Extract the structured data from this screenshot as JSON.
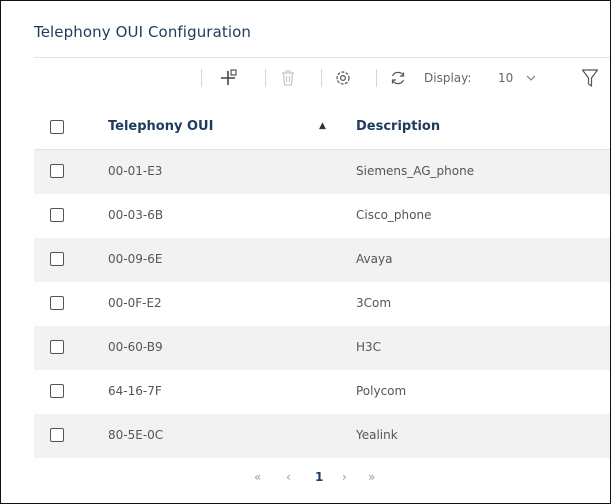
{
  "panel": {
    "title": "Telephony OUI Configuration"
  },
  "toolbar": {
    "add_icon": "add-icon",
    "delete_icon": "trash-icon",
    "settings_icon": "gear-icon",
    "refresh_icon": "refresh-icon",
    "display_label": "Display:",
    "display_value": "10",
    "filter_icon": "filter-icon"
  },
  "table": {
    "columns": [
      "Telephony OUI",
      "Description"
    ],
    "sort_indicator": "▲",
    "rows": [
      {
        "oui": "00-01-E3",
        "description": "Siemens_AG_phone"
      },
      {
        "oui": "00-03-6B",
        "description": "Cisco_phone"
      },
      {
        "oui": "00-09-6E",
        "description": "Avaya"
      },
      {
        "oui": "00-0F-E2",
        "description": "3Com"
      },
      {
        "oui": "00-60-B9",
        "description": "H3C"
      },
      {
        "oui": "64-16-7F",
        "description": "Polycom"
      },
      {
        "oui": "80-5E-0C",
        "description": "Yealink"
      }
    ]
  },
  "pagination": {
    "first": "«",
    "prev": "‹",
    "current": "1",
    "next": "›",
    "last": "»"
  }
}
